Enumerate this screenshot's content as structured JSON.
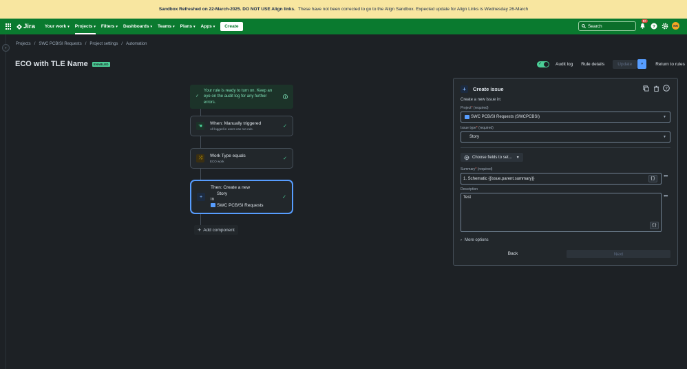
{
  "banner": {
    "bold": "Sandbox Refreshed on 22-March-2025.  DO NOT USE Align links.",
    "rest": "These have not been corrected to go to the Align Sandbox.  Expected update for Align Links is Wednesday 26-March"
  },
  "nav": {
    "logo": "Jira",
    "items": [
      {
        "label": "Your work"
      },
      {
        "label": "Projects"
      },
      {
        "label": "Filters"
      },
      {
        "label": "Dashboards"
      },
      {
        "label": "Teams"
      },
      {
        "label": "Plans"
      },
      {
        "label": "Apps"
      }
    ],
    "create": "Create",
    "search_placeholder": "Search",
    "notif_count": "9+",
    "avatar_initials": "NN"
  },
  "breadcrumbs": [
    "Projects",
    "SWC PCB/SI Requests",
    "Project settings",
    "Automation"
  ],
  "rule": {
    "name": "ECO with TLE Name",
    "status": "ENABLED"
  },
  "actions": {
    "audit_log": "Audit log",
    "rule_details": "Rule details",
    "update": "Update",
    "return": "Return to rules"
  },
  "success": {
    "text": "Your rule is ready to turn on. Keep an eye on the audit log for any further errors."
  },
  "nodes": {
    "trigger": {
      "title": "When: Manually triggered",
      "sub": "All logged in users can run rule."
    },
    "condition": {
      "title": "Work Type equals",
      "sub": "ECO work"
    },
    "action": {
      "title": "Then: Create a new",
      "type": "Story",
      "in": "in",
      "project": "SWC PCB/SI Requests"
    }
  },
  "add_component": "Add component",
  "panel": {
    "title": "Create issue",
    "intro": "Create a new issue in:",
    "project_label": "Project",
    "required": "(required)",
    "project_value": "SWC PCB/SI Requests (SWCPCBSI)",
    "issue_type_label": "Issue type",
    "issue_type_value": "Story",
    "choose_fields": "Choose fields to set...",
    "summary_label": "Summary",
    "summary_value": "1. Schematic {{issue.parent.summary}}",
    "description_label": "Description",
    "description_value": "Test",
    "curly": "{}",
    "more_options": "More options",
    "back": "Back",
    "next": "Next"
  },
  "colors": {
    "nav_green": "#0a7a2f",
    "banner_yellow": "#f8e6a0",
    "enabled_green": "#4bce97",
    "selected_blue": "#579dff"
  }
}
